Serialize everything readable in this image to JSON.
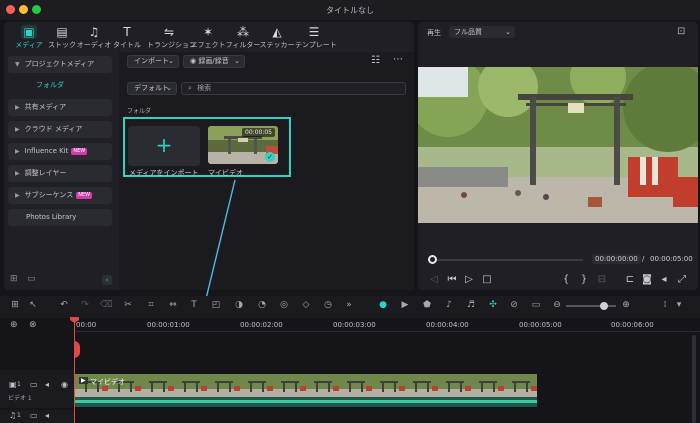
{
  "window": {
    "title": "タイトルなし"
  },
  "tabs": [
    {
      "label": "メディア",
      "icon": "media-icon"
    },
    {
      "label": "ストック",
      "icon": "stock-icon"
    },
    {
      "label": "オーディオ",
      "icon": "audio-icon"
    },
    {
      "label": "タイトル",
      "icon": "title-icon"
    },
    {
      "label": "トランジション",
      "icon": "transition-icon"
    },
    {
      "label": "エフェクト",
      "icon": "effect-icon"
    },
    {
      "label": "フィルター",
      "icon": "filter-icon"
    },
    {
      "label": "ステッカー",
      "icon": "sticker-icon"
    },
    {
      "label": "テンプレート",
      "icon": "template-icon"
    }
  ],
  "sidebar": {
    "items": [
      {
        "label": "プロジェクトメディア",
        "expanded": true
      },
      {
        "label": "共有メディア"
      },
      {
        "label": "クラウド メディア"
      },
      {
        "label": "Influence Kit",
        "badge": "NEW"
      },
      {
        "label": "調整レイヤー"
      },
      {
        "label": "サブシーケンス",
        "badge": "NEW"
      }
    ],
    "sub_item": "フォルダ",
    "library": "Photos Library"
  },
  "media": {
    "import_dropdown": "インポート",
    "record_dropdown": "録画/録音",
    "sort_dropdown": "デフォルト",
    "search_placeholder": "検索",
    "folder_label": "フォルダ",
    "import_label": "メディアをインポート",
    "clip_label": "マイビデオ",
    "clip_duration": "00:00:05"
  },
  "preview": {
    "play_label": "再生",
    "quality": "フル品質",
    "current_time": "00:00:00:00",
    "separator": "/",
    "total_time": "00:00:05:00"
  },
  "timeline": {
    "ruler": [
      "00:00",
      "00:00:01:00",
      "00:00:02:00",
      "00:00:03:00",
      "00:00:04:00",
      "00:00:05:00",
      "00:00:06:00"
    ],
    "video_track_label": "ビデオ 1",
    "video_track_num": "1",
    "audio_track_num": "1",
    "clip_label": "マイビデオ"
  },
  "colors": {
    "accent": "#2fd3c4",
    "badge": "#d43aa6",
    "playhead": "#e24a4a",
    "clip": "#2b6b58"
  }
}
